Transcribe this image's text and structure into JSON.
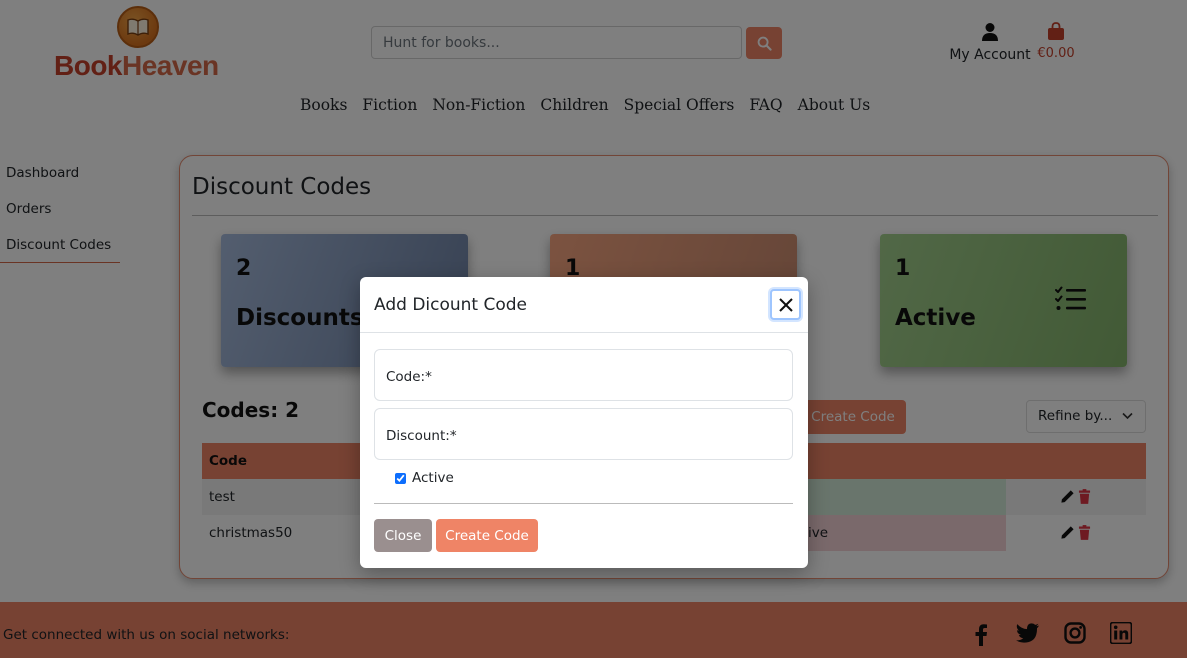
{
  "brand": {
    "part1": "Book",
    "part2": "Heaven",
    "logo_icon": "open-book-icon"
  },
  "search": {
    "placeholder": "Hunt for books...",
    "button_icon": "search-icon"
  },
  "account": {
    "label": "My Account",
    "icon": "user-icon"
  },
  "cart": {
    "amount": "€0.00",
    "icon": "shopping-bag-icon"
  },
  "nav": [
    "Books",
    "Fiction",
    "Non-Fiction",
    "Children",
    "Special Offers",
    "FAQ",
    "About Us"
  ],
  "sidebar": {
    "items": [
      {
        "label": "Dashboard",
        "active": false
      },
      {
        "label": "Orders",
        "active": false
      },
      {
        "label": "Discount Codes",
        "active": true
      }
    ]
  },
  "page": {
    "title": "Discount Codes"
  },
  "stats": [
    {
      "number": "2",
      "caption": "Discounts",
      "color": "#8fa3c6"
    },
    {
      "number": "1",
      "caption": "",
      "color": "#e99b78"
    },
    {
      "number": "1",
      "caption": "Active",
      "color": "#95c47e",
      "icon": "checklist-icon"
    }
  ],
  "codes": {
    "heading": "Codes: 2",
    "create_label": "Create Code",
    "refine_label": "Refine by...",
    "columns": [
      "Code"
    ],
    "rows": [
      {
        "code": "test",
        "status": "",
        "actions": [
          "edit-icon",
          "delete-icon"
        ]
      },
      {
        "code": "christmas50",
        "status": "ive",
        "actions": [
          "edit-icon",
          "delete-icon"
        ]
      }
    ]
  },
  "footer": {
    "text": "Get connected with us on social networks:",
    "socials": [
      "facebook-icon",
      "twitter-icon",
      "instagram-icon",
      "linkedin-icon"
    ]
  },
  "modal": {
    "title": "Add Dicount Code",
    "fields": [
      {
        "label": "Code:*",
        "value": ""
      },
      {
        "label": "Discount:*",
        "value": ""
      }
    ],
    "active_label": "Active",
    "active_checked": true,
    "close_label": "Close",
    "create_label": "Create Code"
  },
  "colors": {
    "accent": "#ef8466",
    "brand_dark": "#c4402b",
    "close_btn": "#9a8f8f",
    "danger": "#dc3545"
  }
}
